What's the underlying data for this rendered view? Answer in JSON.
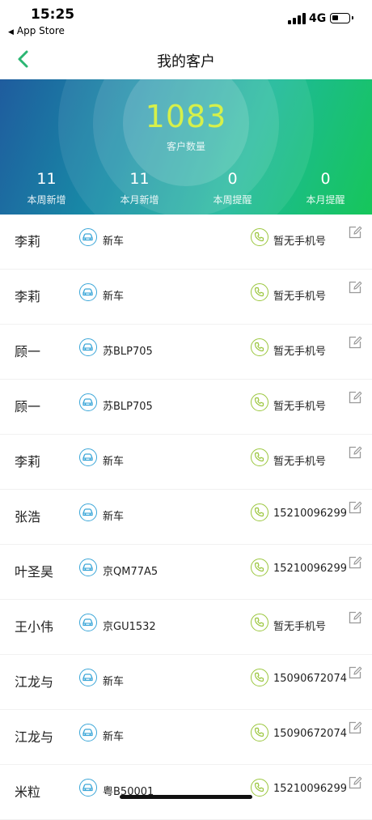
{
  "status_bar": {
    "time": "15:25",
    "back_app": "App Store",
    "network": "4G"
  },
  "nav": {
    "title": "我的客户"
  },
  "summary": {
    "total": "1083",
    "total_label": "客户数量",
    "stats": [
      {
        "value": "11",
        "label": "本周新增"
      },
      {
        "value": "11",
        "label": "本月新增"
      },
      {
        "value": "0",
        "label": "本周提醒"
      },
      {
        "value": "0",
        "label": "本月提醒"
      }
    ]
  },
  "customers": [
    {
      "name": "李莉",
      "car": "新车",
      "phone": "暂无手机号"
    },
    {
      "name": "李莉",
      "car": "新车",
      "phone": "暂无手机号"
    },
    {
      "name": "顾一",
      "car": "苏BLP705",
      "phone": "暂无手机号"
    },
    {
      "name": "顾一",
      "car": "苏BLP705",
      "phone": "暂无手机号"
    },
    {
      "name": "李莉",
      "car": "新车",
      "phone": "暂无手机号"
    },
    {
      "name": "张浩",
      "car": "新车",
      "phone": "15210096299"
    },
    {
      "name": "叶圣昊",
      "car": "京QM77A5",
      "phone": "15210096299"
    },
    {
      "name": "王小伟",
      "car": "京GU1532",
      "phone": "暂无手机号"
    },
    {
      "name": "江龙与",
      "car": "新车",
      "phone": "15090672074"
    },
    {
      "name": "江龙与",
      "car": "新车",
      "phone": "15090672074"
    },
    {
      "name": "米粒",
      "car": "粤B50001",
      "phone": "15210096299"
    }
  ],
  "colors": {
    "accent_green": "#2bb673",
    "car_icon": "#3aa6d8",
    "phone_icon": "#9ac63c",
    "total_number": "#d6f04a"
  }
}
